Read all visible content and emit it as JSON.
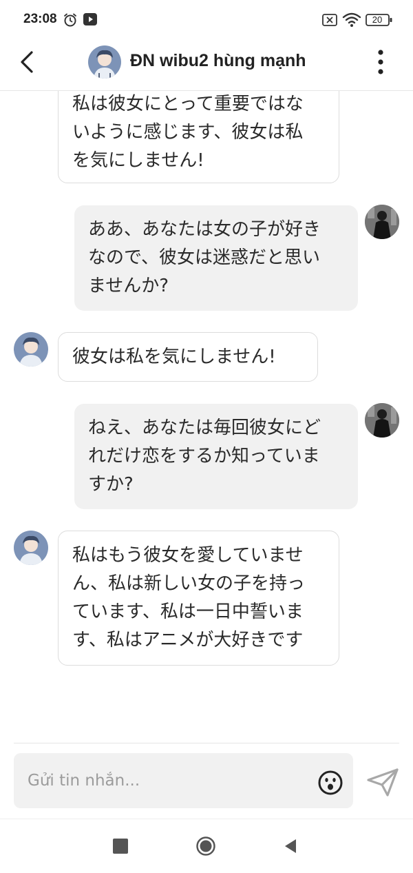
{
  "status_bar": {
    "time": "23:08",
    "battery": "20",
    "icons": [
      "alarm-icon",
      "youtube-icon",
      "no-sim-icon",
      "wifi-icon",
      "battery-icon"
    ]
  },
  "header": {
    "title": "ĐN wibu2 hùng mạnh",
    "icons": [
      "back-arrow-icon",
      "avatar",
      "more-vertical-icon"
    ]
  },
  "messages": [
    {
      "sender": "contact",
      "lines": [
        "私は彼女にとって重要ではな",
        "いように感じます、彼女は私",
        "を気にしません!"
      ]
    },
    {
      "sender": "me",
      "lines": [
        "ああ、あなたは女の子が好き",
        "なので、彼女は迷惑だと思い",
        "ませんか?"
      ]
    },
    {
      "sender": "contact",
      "lines": [
        "彼女は私を気にしません!"
      ]
    },
    {
      "sender": "me",
      "lines": [
        "ねえ、あなたは毎回彼女にど",
        "れだけ恋をするか知っていま",
        "すか?"
      ]
    },
    {
      "sender": "contact",
      "lines": [
        "私はもう彼女を愛していませ",
        "ん、私は新しい女の子を持っ",
        "ています、私は一日中誓いま",
        "す、私はアニメが大好きです"
      ]
    }
  ],
  "composer": {
    "placeholder": "Gửi tin nhắn...",
    "value": "",
    "icons": [
      "emoji-icon",
      "send-icon"
    ]
  },
  "nav_bar": {
    "icons": [
      "recents-square-icon",
      "home-circle-icon",
      "back-triangle-icon"
    ]
  },
  "colors": {
    "outgoing_bubble": "#f1f1f1",
    "incoming_border": "#dcdcdc",
    "text": "#222222"
  }
}
